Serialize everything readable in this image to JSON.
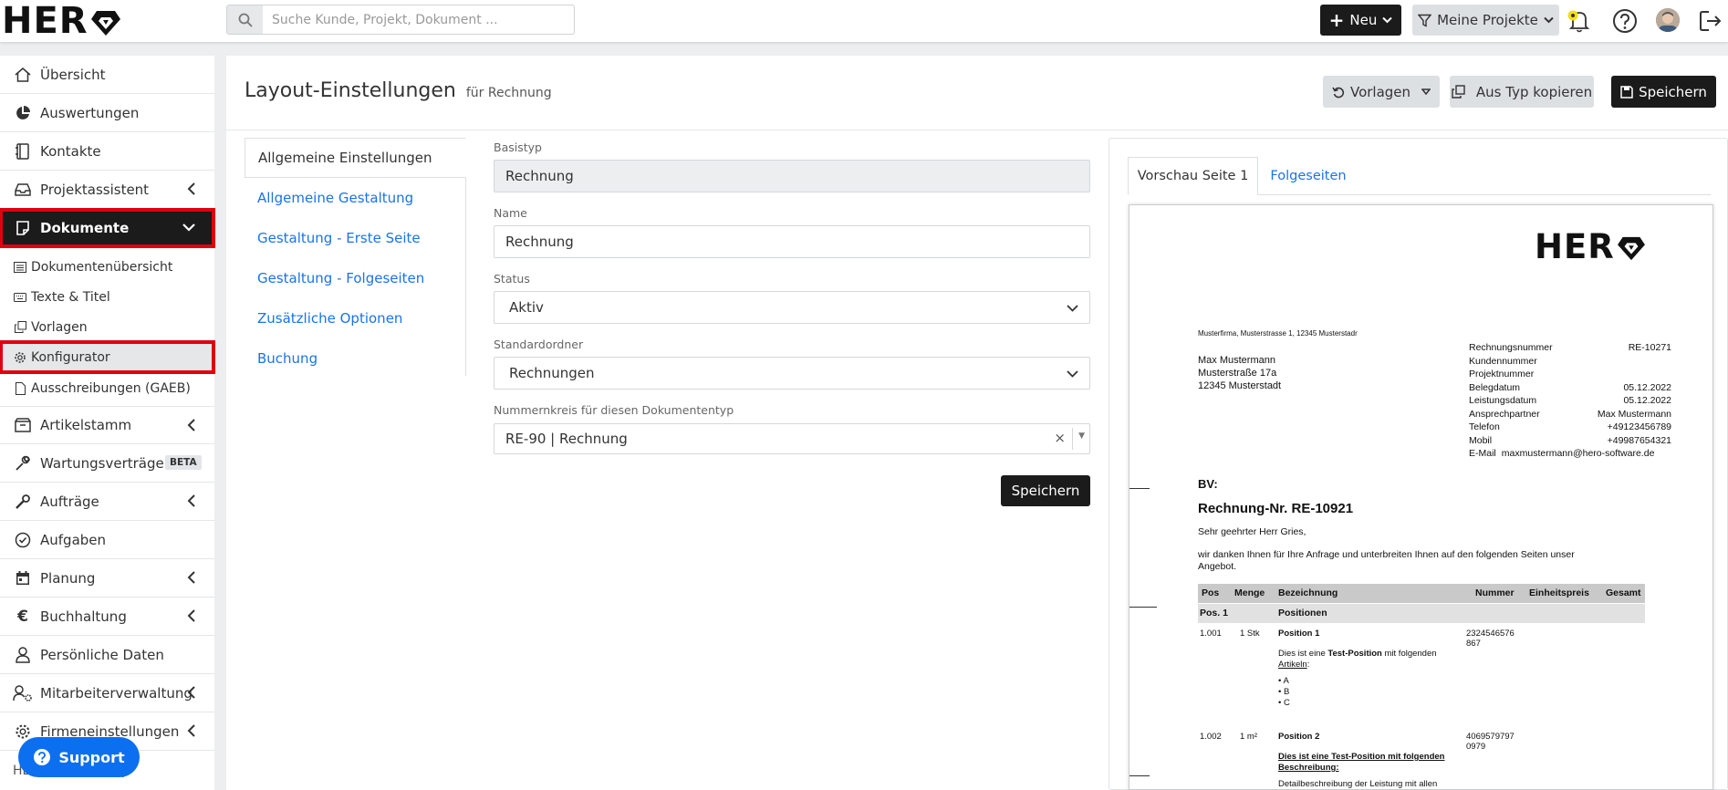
{
  "header": {
    "logo_text": "HER",
    "search_placeholder": "Suche Kunde, Projekt, Dokument ...",
    "new_label": "Neu",
    "projects_label": "Meine Projekte"
  },
  "sidebar": {
    "items": [
      {
        "label": "Übersicht",
        "icon": "home-icon"
      },
      {
        "label": "Auswertungen",
        "icon": "pie-chart-icon"
      },
      {
        "label": "Kontakte",
        "icon": "address-book-icon"
      },
      {
        "label": "Projektassistent",
        "icon": "inbox-icon"
      },
      {
        "label": "Dokumente",
        "icon": "document-icon"
      },
      {
        "label": "Artikelstamm",
        "icon": "box-icon"
      },
      {
        "label": "Wartungsverträge",
        "icon": "wrench-icon",
        "badge": "BETA"
      },
      {
        "label": "Aufträge",
        "icon": "tools-icon"
      },
      {
        "label": "Aufgaben",
        "icon": "check-circle-icon"
      },
      {
        "label": "Planung",
        "icon": "calendar-icon"
      },
      {
        "label": "Buchhaltung",
        "icon": "euro-icon"
      },
      {
        "label": "Persönliche Daten",
        "icon": "user-icon"
      },
      {
        "label": "Mitarbeiterverwaltung",
        "icon": "users-gear-icon"
      },
      {
        "label": "Firmeneinstellungen",
        "icon": "gear-icon"
      }
    ],
    "subitems": [
      {
        "label": "Dokumentenübersicht"
      },
      {
        "label": "Texte & Titel"
      },
      {
        "label": "Vorlagen"
      },
      {
        "label": "Konfigurator"
      },
      {
        "label": "Ausschreibungen (GAEB)"
      }
    ],
    "footer_text": "HERO-Community",
    "support_label": "Support"
  },
  "page": {
    "title": "Layout-Einstellungen",
    "subtitle": "für Rechnung",
    "templates_label": "Vorlagen",
    "copy_label": "Aus Typ kopieren",
    "save_label": "Speichern"
  },
  "settings_tabs": [
    "Allgemeine Einstellungen",
    "Allgemeine Gestaltung",
    "Gestaltung - Erste Seite",
    "Gestaltung - Folgeseiten",
    "Zusätzliche Optionen",
    "Buchung"
  ],
  "form": {
    "basistyp": {
      "label": "Basistyp",
      "value": "Rechnung"
    },
    "name": {
      "label": "Name",
      "value": "Rechnung"
    },
    "status": {
      "label": "Status",
      "value": "Aktiv"
    },
    "folder": {
      "label": "Standardordner",
      "value": "Rechnungen"
    },
    "numbering": {
      "label": "Nummernkreis für diesen Dokumententyp",
      "value": "RE-90 | Rechnung"
    },
    "save_label": "Speichern"
  },
  "preview": {
    "tabs": [
      "Vorschau Seite 1",
      "Folgeseiten"
    ],
    "doc": {
      "logo_text": "HER",
      "sender_line": "Musterfirma, Musterstrasse 1, 12345 Musterstadr",
      "address": [
        "Max Mustermann",
        "Musterstraße 17a",
        "12345 Musterstadt"
      ],
      "info": [
        [
          "Rechnungsnummer",
          "RE-10271"
        ],
        [
          "Kundennummer",
          ""
        ],
        [
          "Projektnummer",
          ""
        ],
        [
          "Belegdatum",
          "05.12.2022"
        ],
        [
          "Leistungsdatum",
          "05.12.2022"
        ],
        [
          "Ansprechpartner",
          "Max Mustermann"
        ],
        [
          "Telefon",
          "+49123456789"
        ],
        [
          "Mobil",
          "+49987654321"
        ],
        [
          "E-Mail",
          "maxmustermann@hero-software.de"
        ]
      ],
      "bv": "BV:",
      "heading": "Rechnung-Nr. RE-10921",
      "salutation": "Sehr geehrter Herr Gries,",
      "intro": "wir danken Ihnen für Ihre Anfrage und unterbreiten Ihnen auf den folgenden Seiten unser",
      "intro2": "Angebot.",
      "table_headers": [
        "Pos",
        "Menge",
        "Bezeichnung",
        "Nummer",
        "Einheitspreis",
        "Gesamt"
      ],
      "group": {
        "pos": "Pos. 1",
        "name": "Positionen"
      },
      "rows": [
        {
          "pos": "1.001",
          "qty": "1 Stk",
          "title": "Position 1",
          "num1": "2324546576",
          "num2": "867"
        },
        {
          "pos": "1.002",
          "qty": "1 m²",
          "title": "Position 2",
          "num1": "4069579797",
          "num2": "0979"
        }
      ],
      "desc1_pre": "Dies ist eine ",
      "desc1_bold": "Test-Position",
      "desc1_post": " mit folgenden",
      "desc1_link": "Artikeln",
      "desc1_colon": ":",
      "bullets": [
        "A",
        "B",
        "C"
      ],
      "desc2_a": "Dies ist eine Test-Position mit folgenden",
      "desc2_b": "Beschreibung:",
      "desc2_c": "Detailbeschreibung der Leistung mit allen"
    }
  }
}
